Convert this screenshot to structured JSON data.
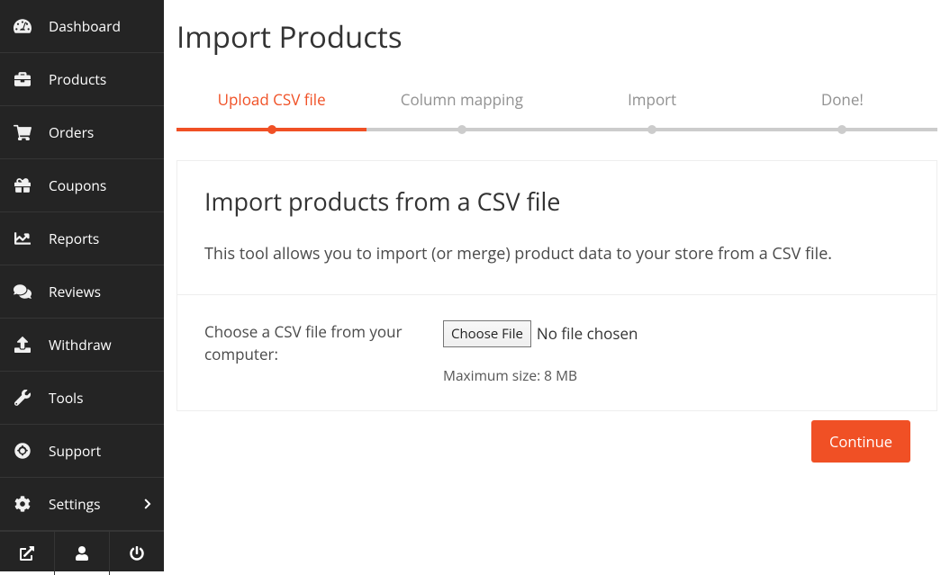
{
  "sidebar": {
    "items": [
      {
        "label": "Dashboard"
      },
      {
        "label": "Products"
      },
      {
        "label": "Orders"
      },
      {
        "label": "Coupons"
      },
      {
        "label": "Reports"
      },
      {
        "label": "Reviews"
      },
      {
        "label": "Withdraw"
      },
      {
        "label": "Tools"
      },
      {
        "label": "Support"
      },
      {
        "label": "Settings"
      }
    ]
  },
  "page": {
    "title": "Import Products"
  },
  "stepper": {
    "steps": [
      {
        "label": "Upload CSV file"
      },
      {
        "label": "Column mapping"
      },
      {
        "label": "Import"
      },
      {
        "label": "Done!"
      }
    ]
  },
  "card": {
    "title": "Import products from a CSV file",
    "description": "This tool allows you to import (or merge) product data to your store from a CSV file.",
    "file_label": "Choose a CSV file from your computer:",
    "choose_button": "Choose File",
    "file_status": "No file chosen",
    "max_size": "Maximum size: 8 MB",
    "continue": "Continue"
  }
}
